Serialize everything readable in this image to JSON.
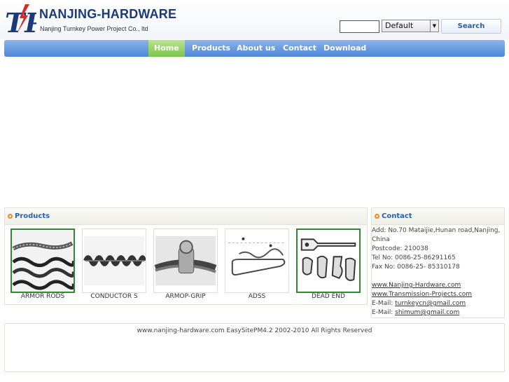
{
  "header": {
    "logo_text": "TP",
    "brand": "NANJING-HARDWARE",
    "tagline": "Nanjing Turnkey Power Project Co., ltd"
  },
  "search": {
    "query": "",
    "select_value": "Default",
    "button_label": "Search"
  },
  "nav": {
    "items": [
      {
        "label": "Home"
      },
      {
        "label": "Products"
      },
      {
        "label": "About us"
      },
      {
        "label": "Contact"
      },
      {
        "label": "Download"
      }
    ]
  },
  "products": {
    "title": "Products",
    "items": [
      {
        "caption": "ARMOR RODS"
      },
      {
        "caption": "CONDUCTOR S"
      },
      {
        "caption": "ARMOP-GRIP"
      },
      {
        "caption": "ADSS"
      },
      {
        "caption": "DEAD END"
      }
    ]
  },
  "contact": {
    "title": "Contact",
    "address_1": "Add: No.70 Mataijie,Hunan road,Nanjing,",
    "address_2": "China",
    "postcode": "Postcode: 210038",
    "tel": "Tel No: 0086-25-86291165",
    "fax": "Fax No: 0086-25- 85310178",
    "site_1": "www.Nanjing-Hardware.com",
    "site_2": "www.Transmission-Projects.com",
    "email_label_1": "E-Mail:",
    "email_1": "turnkeycn@gmail.com",
    "email_label_2": "E-Mail:",
    "email_2": "shimum@gmail.com"
  },
  "footer": {
    "text": "www.nanjing-hardware.com EasySitePM4.2 2002-2010 All Rights Reserved"
  },
  "colors": {
    "brand": "#1b3a7a",
    "logo_red": "#d8282a",
    "nav_blue": "#5a8fdc",
    "nav_active": "#8dd05a",
    "panel_title": "#2a5faa",
    "bullet": "#f08a24"
  }
}
